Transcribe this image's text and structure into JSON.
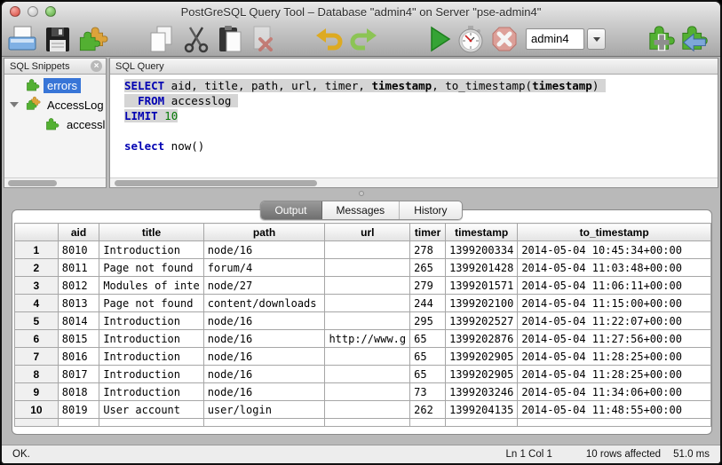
{
  "window": {
    "title": "PostGreSQL Query Tool – Database \"admin4\" on Server \"pse-admin4\""
  },
  "toolbar": {
    "buttons": [
      "open-icon",
      "save-icon",
      "snippets-icon",
      "copy-icon",
      "cut-icon",
      "paste-icon",
      "delete-icon",
      "undo-icon",
      "redo-icon",
      "run-icon",
      "stopwatch-icon",
      "stop-icon",
      "add-snippet-icon",
      "insert-snippet-icon"
    ],
    "db_selector": {
      "value": "admin4"
    }
  },
  "sidebar": {
    "title": "SQL Snippets",
    "close_icon": "close-icon",
    "items": [
      {
        "label": "errors",
        "icon": "puzzle-icon",
        "selected": true,
        "indent": 1,
        "disclosure": false
      },
      {
        "label": "AccessLog",
        "icon": "puzzle-pair-icon",
        "selected": false,
        "indent": 1,
        "disclosure": true
      },
      {
        "label": "accessl",
        "icon": "puzzle-icon",
        "selected": false,
        "indent": 2,
        "disclosure": false
      }
    ]
  },
  "editor": {
    "title": "SQL Query",
    "lines": [
      {
        "highlight": true,
        "segments": [
          {
            "c": "k",
            "t": "SELECT"
          },
          {
            "c": "",
            "t": " aid, title, path, url, timer, "
          },
          {
            "c": "b",
            "t": "timestamp"
          },
          {
            "c": "",
            "t": ", to_timestamp("
          },
          {
            "c": "b",
            "t": "timestamp"
          },
          {
            "c": "",
            "t": ") "
          }
        ]
      },
      {
        "highlight": true,
        "segments": [
          {
            "c": "",
            "t": "  "
          },
          {
            "c": "k",
            "t": "FROM"
          },
          {
            "c": "",
            "t": " accesslog "
          }
        ]
      },
      {
        "highlight": true,
        "segments": [
          {
            "c": "k",
            "t": "LIMIT"
          },
          {
            "c": "",
            "t": " "
          },
          {
            "c": "n",
            "t": "10"
          }
        ]
      },
      {
        "highlight": false,
        "segments": []
      },
      {
        "highlight": false,
        "segments": [
          {
            "c": "k",
            "t": "select"
          },
          {
            "c": "",
            "t": " now()"
          }
        ]
      }
    ]
  },
  "tabs": [
    {
      "label": "Output",
      "active": true
    },
    {
      "label": "Messages",
      "active": false
    },
    {
      "label": "History",
      "active": false
    }
  ],
  "table": {
    "columns": [
      "",
      "aid",
      "title",
      "path",
      "url",
      "timer",
      "timestamp",
      "to_timestamp"
    ],
    "rows": [
      {
        "num": "1",
        "aid": "8010",
        "title": "Introduction",
        "path": "node/16",
        "url": "",
        "timer": "278",
        "timestamp": "1399200334",
        "to_timestamp": "2014-05-04 10:45:34+00:00"
      },
      {
        "num": "2",
        "aid": "8011",
        "title": "Page not found",
        "path": "forum/4",
        "url": "",
        "timer": "265",
        "timestamp": "1399201428",
        "to_timestamp": "2014-05-04 11:03:48+00:00"
      },
      {
        "num": "3",
        "aid": "8012",
        "title": "Modules of inte",
        "path": "node/27",
        "url": "",
        "timer": "279",
        "timestamp": "1399201571",
        "to_timestamp": "2014-05-04 11:06:11+00:00"
      },
      {
        "num": "4",
        "aid": "8013",
        "title": "Page not found",
        "path": "content/downloads",
        "url": "",
        "timer": "244",
        "timestamp": "1399202100",
        "to_timestamp": "2014-05-04 11:15:00+00:00"
      },
      {
        "num": "5",
        "aid": "8014",
        "title": "Introduction",
        "path": "node/16",
        "url": "",
        "timer": "295",
        "timestamp": "1399202527",
        "to_timestamp": "2014-05-04 11:22:07+00:00"
      },
      {
        "num": "6",
        "aid": "8015",
        "title": "Introduction",
        "path": "node/16",
        "url": "http://www.g",
        "timer": "65",
        "timestamp": "1399202876",
        "to_timestamp": "2014-05-04 11:27:56+00:00"
      },
      {
        "num": "7",
        "aid": "8016",
        "title": "Introduction",
        "path": "node/16",
        "url": "",
        "timer": "65",
        "timestamp": "1399202905",
        "to_timestamp": "2014-05-04 11:28:25+00:00"
      },
      {
        "num": "8",
        "aid": "8017",
        "title": "Introduction",
        "path": "node/16",
        "url": "",
        "timer": "65",
        "timestamp": "1399202905",
        "to_timestamp": "2014-05-04 11:28:25+00:00"
      },
      {
        "num": "9",
        "aid": "8018",
        "title": "Introduction",
        "path": "node/16",
        "url": "",
        "timer": "73",
        "timestamp": "1399203246",
        "to_timestamp": "2014-05-04 11:34:06+00:00"
      },
      {
        "num": "10",
        "aid": "8019",
        "title": "User account",
        "path": "user/login",
        "url": "",
        "timer": "262",
        "timestamp": "1399204135",
        "to_timestamp": "2014-05-04 11:48:55+00:00"
      }
    ]
  },
  "statusbar": {
    "status": "OK.",
    "position": "Ln 1 Col 1",
    "rows_affected": "10 rows affected",
    "duration": "51.0 ms"
  }
}
